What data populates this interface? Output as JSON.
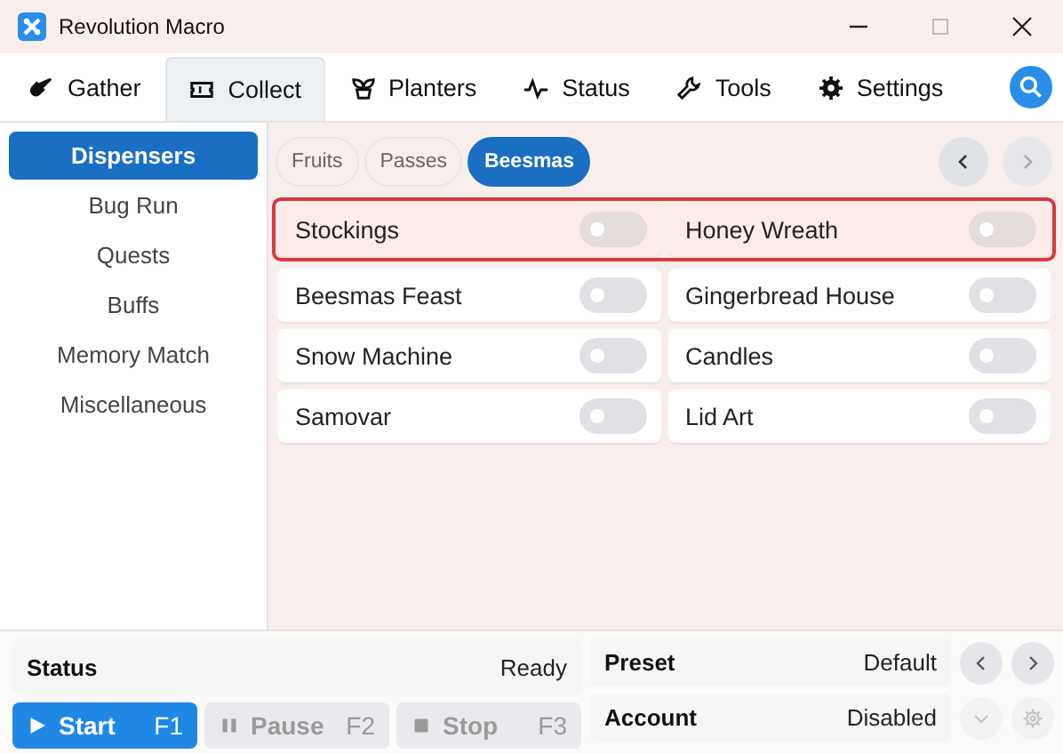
{
  "window": {
    "title": "Revolution Macro"
  },
  "tabs": [
    {
      "label": "Gather",
      "selected": false
    },
    {
      "label": "Collect",
      "selected": true
    },
    {
      "label": "Planters",
      "selected": false
    },
    {
      "label": "Status",
      "selected": false
    },
    {
      "label": "Tools",
      "selected": false
    },
    {
      "label": "Settings",
      "selected": false
    }
  ],
  "sidebar": {
    "items": [
      {
        "label": "Dispensers",
        "selected": true
      },
      {
        "label": "Bug Run",
        "selected": false
      },
      {
        "label": "Quests",
        "selected": false
      },
      {
        "label": "Buffs",
        "selected": false
      },
      {
        "label": "Memory Match",
        "selected": false
      },
      {
        "label": "Miscellaneous",
        "selected": false
      }
    ]
  },
  "subtabs": [
    {
      "label": "Fruits",
      "selected": false
    },
    {
      "label": "Passes",
      "selected": false
    },
    {
      "label": "Beesmas",
      "selected": true
    }
  ],
  "rows": [
    {
      "highlighted": true,
      "items": [
        {
          "label": "Stockings",
          "on": false
        },
        {
          "label": "Honey Wreath",
          "on": false
        }
      ]
    },
    {
      "highlighted": false,
      "items": [
        {
          "label": "Beesmas Feast",
          "on": false
        },
        {
          "label": "Gingerbread House",
          "on": false
        }
      ]
    },
    {
      "highlighted": false,
      "items": [
        {
          "label": "Snow Machine",
          "on": false
        },
        {
          "label": "Candles",
          "on": false
        }
      ]
    },
    {
      "highlighted": false,
      "items": [
        {
          "label": "Samovar",
          "on": false
        },
        {
          "label": "Lid Art",
          "on": false
        }
      ]
    }
  ],
  "status": {
    "label": "Status",
    "value": "Ready"
  },
  "controls": [
    {
      "kind": "play",
      "label": "Start",
      "key": "F1",
      "disabled": false
    },
    {
      "kind": "pause",
      "label": "Pause",
      "key": "F2",
      "disabled": true
    },
    {
      "kind": "stop",
      "label": "Stop",
      "key": "F3",
      "disabled": true
    }
  ],
  "preset": {
    "label": "Preset",
    "value": "Default"
  },
  "account": {
    "label": "Account",
    "value": "Disabled",
    "disabled": true
  }
}
